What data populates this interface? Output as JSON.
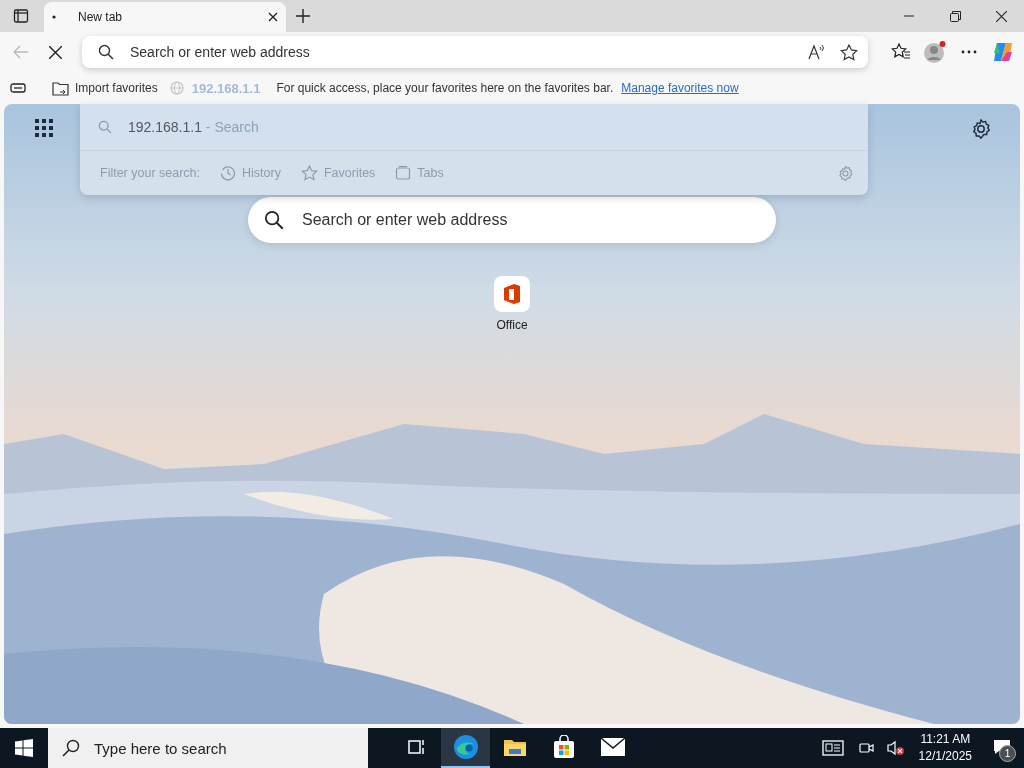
{
  "tab_strip": {
    "tabs": [
      {
        "title": "New tab",
        "selected": true
      }
    ]
  },
  "toolbar": {
    "back_disabled": true,
    "address_field": {
      "placeholder": "Search or enter web address"
    }
  },
  "favorites_bar": {
    "import_label": "Import favorites",
    "ghost_suggestion": "192.168.1.1",
    "message": "For quick access, place your favorites here on the favorites bar.",
    "link": "Manage favorites now"
  },
  "suggestions_dropdown": {
    "suggestions": [
      {
        "query": "192.168.1.1",
        "suffix": "- Search"
      }
    ],
    "filter_label": "Filter your search:",
    "filters": [
      {
        "kind": "history",
        "label": "History"
      },
      {
        "kind": "favorites",
        "label": "Favorites"
      },
      {
        "kind": "tabs",
        "label": "Tabs"
      }
    ]
  },
  "new_tab_page": {
    "search": {
      "placeholder": "Search or enter web address"
    },
    "quick_links": [
      {
        "label": "Office"
      }
    ]
  },
  "taskbar": {
    "search": {
      "placeholder": "Type here to search"
    },
    "apps": [
      {
        "kind": "task-view",
        "selected": false
      },
      {
        "kind": "edge",
        "selected": true
      },
      {
        "kind": "file-explorer",
        "selected": false
      },
      {
        "kind": "store",
        "selected": false
      },
      {
        "kind": "mail",
        "selected": false
      }
    ],
    "time": "11:21 AM",
    "date": "12/1/2025",
    "notification_count": "1"
  }
}
